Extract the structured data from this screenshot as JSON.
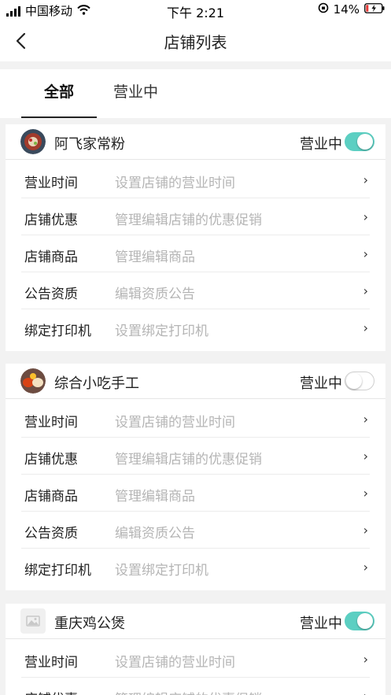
{
  "status_bar": {
    "carrier": "中国移动",
    "time": "下午 2:21",
    "battery": "14%"
  },
  "nav": {
    "title": "店铺列表"
  },
  "tabs": [
    {
      "label": "全部",
      "active": true
    },
    {
      "label": "营业中",
      "active": false
    }
  ],
  "shops": [
    {
      "name": "阿飞家常粉",
      "status_label": "营业中",
      "open": true,
      "rows": [
        {
          "label": "营业时间",
          "desc": "设置店铺的营业时间"
        },
        {
          "label": "店铺优惠",
          "desc": "管理编辑店铺的优惠促销"
        },
        {
          "label": "店铺商品",
          "desc": "管理编辑商品"
        },
        {
          "label": "公告资质",
          "desc": "编辑资质公告"
        },
        {
          "label": "绑定打印机",
          "desc": "设置绑定打印机"
        }
      ]
    },
    {
      "name": "综合小吃手工",
      "status_label": "营业中",
      "open": false,
      "rows": [
        {
          "label": "营业时间",
          "desc": "设置店铺的营业时间"
        },
        {
          "label": "店铺优惠",
          "desc": "管理编辑店铺的优惠促销"
        },
        {
          "label": "店铺商品",
          "desc": "管理编辑商品"
        },
        {
          "label": "公告资质",
          "desc": "编辑资质公告"
        },
        {
          "label": "绑定打印机",
          "desc": "设置绑定打印机"
        }
      ]
    },
    {
      "name": "重庆鸡公煲",
      "status_label": "营业中",
      "open": true,
      "rows": [
        {
          "label": "营业时间",
          "desc": "设置店铺的营业时间"
        },
        {
          "label": "店铺优惠",
          "desc": "管理编辑店铺的优惠促销"
        }
      ]
    }
  ],
  "arrow_glyph": "›",
  "colors": {
    "toggle_on": "#5ccfc2",
    "muted_text": "#b5b5b5"
  }
}
